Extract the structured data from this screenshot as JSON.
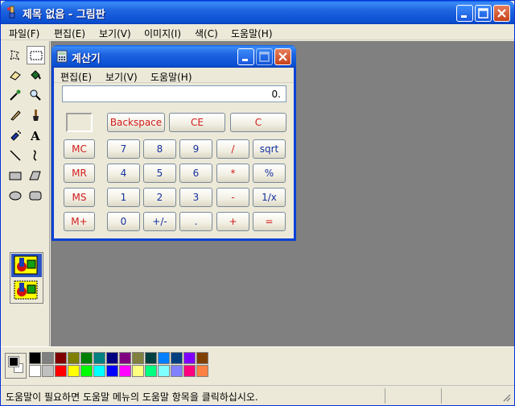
{
  "paint": {
    "title": "제목 없음 - 그림판",
    "menu": [
      "파일(F)",
      "편집(E)",
      "보기(V)",
      "이미지(I)",
      "색(C)",
      "도움말(H)"
    ],
    "tools": [
      "free-select",
      "rect-select",
      "eraser",
      "fill",
      "color-picker",
      "magnifier",
      "pencil",
      "brush",
      "airbrush",
      "text",
      "line",
      "curve",
      "rectangle",
      "polygon",
      "ellipse",
      "rounded-rect"
    ],
    "palette_top": [
      "#000000",
      "#808080",
      "#800000",
      "#808000",
      "#008000",
      "#008080",
      "#000080",
      "#800080",
      "#808040",
      "#004040",
      "#0080ff",
      "#004080",
      "#8000ff",
      "#804000"
    ],
    "palette_bottom": [
      "#ffffff",
      "#c0c0c0",
      "#ff0000",
      "#ffff00",
      "#00ff00",
      "#00ffff",
      "#0000ff",
      "#ff00ff",
      "#ffff80",
      "#00ff80",
      "#80ffff",
      "#8080ff",
      "#ff0080",
      "#ff8040"
    ],
    "foreground_color": "#000000",
    "background_color": "#ffffff",
    "status": "도움말이 필요하면 도움말 메뉴의 도움말 항목을 클릭하십시오."
  },
  "calc": {
    "title": "계산기",
    "menu": [
      "편집(E)",
      "보기(V)",
      "도움말(H)"
    ],
    "display": "0.",
    "top_row": [
      "Backspace",
      "CE",
      "C"
    ],
    "memory": [
      "MC",
      "MR",
      "MS",
      "M+"
    ],
    "keys": [
      [
        "7",
        "8",
        "9",
        "/",
        "sqrt"
      ],
      [
        "4",
        "5",
        "6",
        "*",
        "%"
      ],
      [
        "1",
        "2",
        "3",
        "-",
        "1/x"
      ],
      [
        "0",
        "+/-",
        ".",
        "+",
        "="
      ]
    ]
  }
}
